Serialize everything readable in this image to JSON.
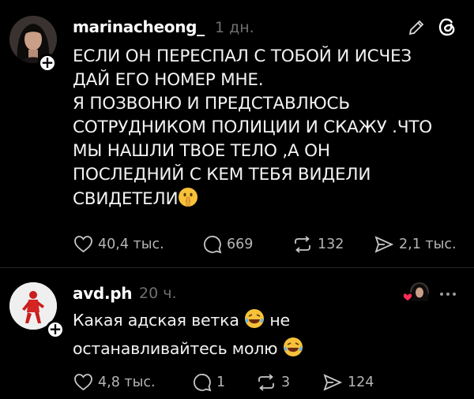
{
  "posts": [
    {
      "username": "marinacheong_",
      "time": "1 дн.",
      "lines": [
        "ЕСЛИ ОН ПЕРЕСПАЛ С ТОБОЙ И ИСЧЕЗ",
        "ДАЙ ЕГО НОМЕР МНЕ.",
        "Я ПОЗВОНЮ И ПРЕДСТАВЛЮСЬ",
        "СОТРУДНИКОМ ПОЛИЦИИ И СКАЖУ .ЧТО",
        "МЫ НАШЛИ ТВОЕ ТЕЛО ,А ОН",
        "ПОСЛЕДНИЙ С КЕМ ТЕБЯ ВИДЕЛИ",
        "СВИДЕТЕЛИ"
      ],
      "emoji_end": "shushing-face",
      "likes": "40,4 тыс.",
      "replies": "669",
      "reposts": "132",
      "shares": "2,1 тыс.",
      "icons": [
        "edit-icon",
        "threads-logo-icon"
      ]
    },
    {
      "username": "avd.ph",
      "time": "20 ч.",
      "line1": "Какая адская ветка",
      "line1_end": "не",
      "line2": "останавливайтесь молю",
      "emoji": "laughing-tears-face",
      "likes": "4,8 тыс.",
      "replies": "1",
      "reposts": "3",
      "shares": "124",
      "icons": [
        "liked-by-author-avatar",
        "heart-icon",
        "more-options-icon"
      ]
    }
  ]
}
